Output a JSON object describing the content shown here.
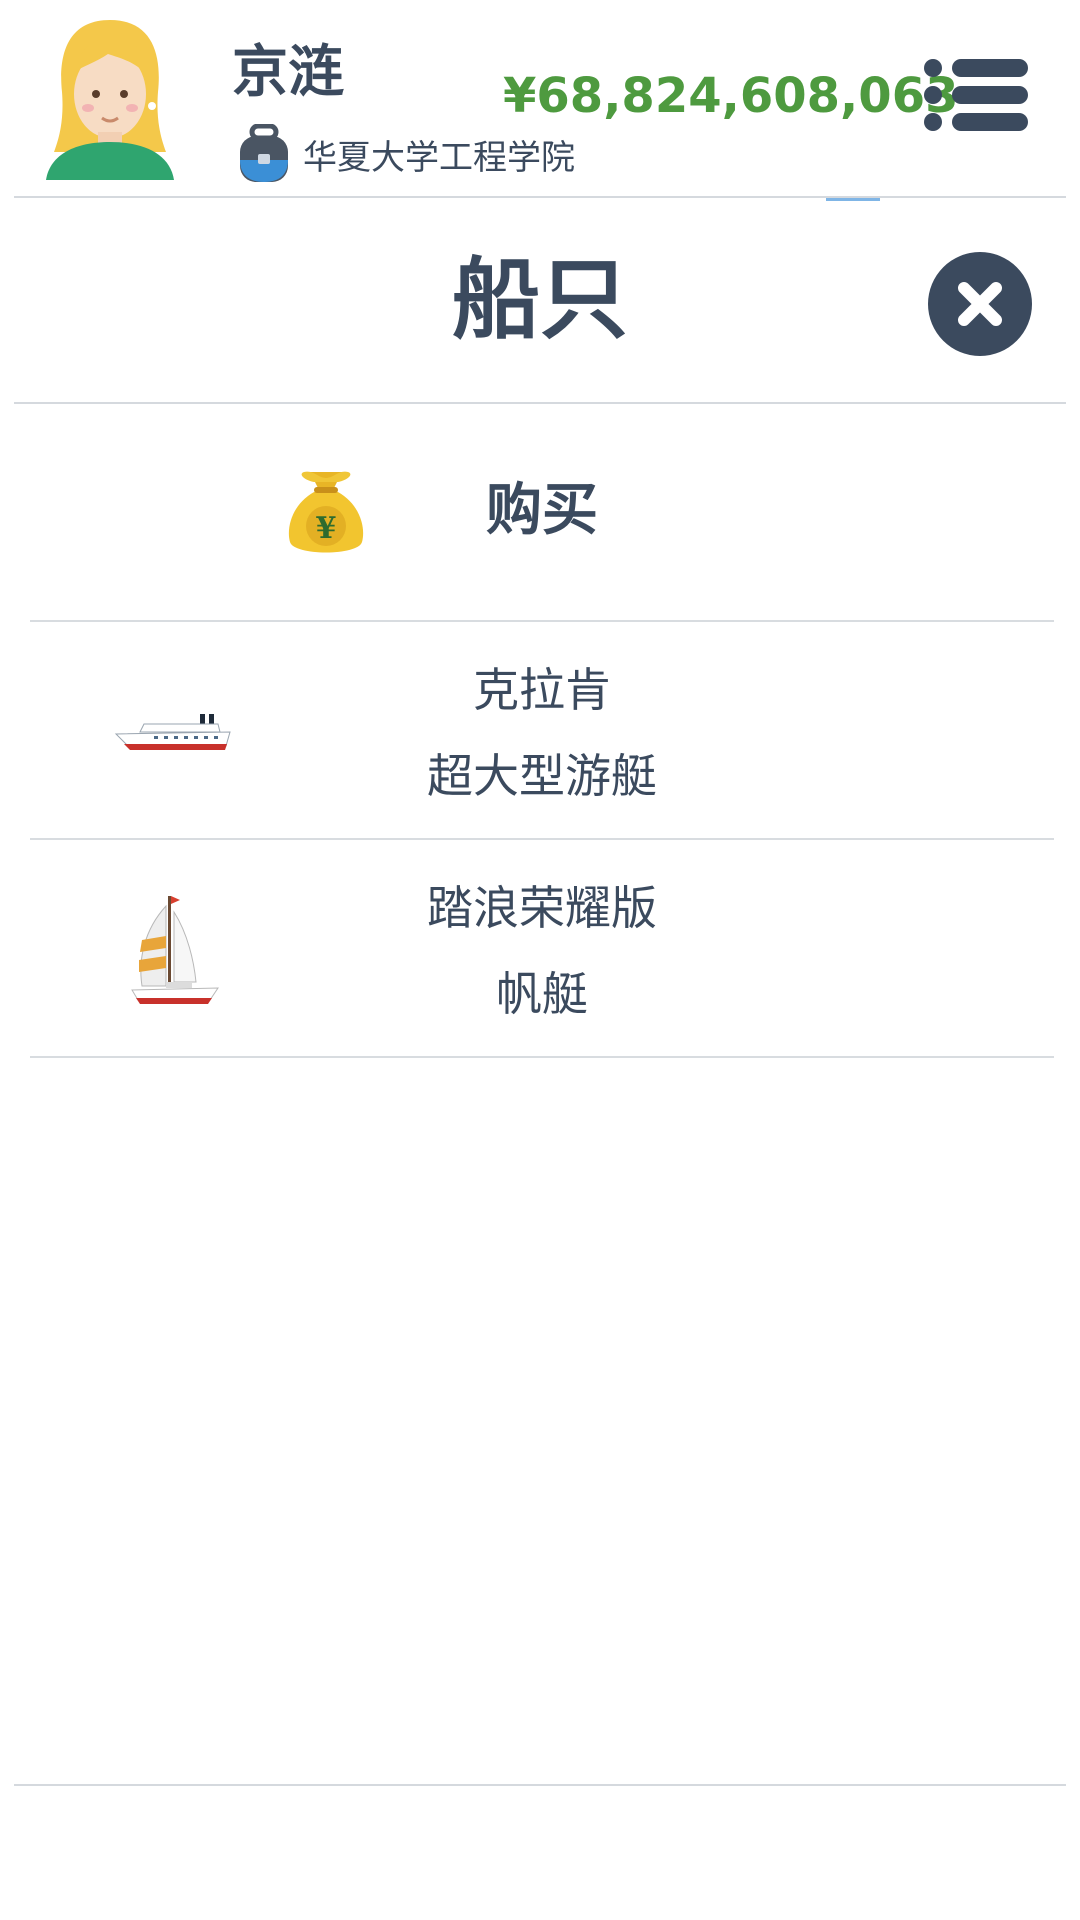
{
  "header": {
    "player_name": "京涟",
    "school": "华夏大学工程学院",
    "money": "¥68,824,608,063",
    "avatar_icon": "blonde-avatar-icon",
    "school_icon": "backpack-icon",
    "menu_icon": "menu-icon",
    "money_color": "#4e9a3f"
  },
  "page": {
    "title": "船只",
    "close_icon": "close-icon"
  },
  "list": {
    "buy": {
      "label": "购买",
      "icon": "money-bag-icon"
    },
    "items": [
      {
        "name": "克拉肯",
        "type": "超大型游艇",
        "icon": "yacht-icon"
      },
      {
        "name": "踏浪荣耀版",
        "type": "帆艇",
        "icon": "sailboat-icon"
      }
    ]
  }
}
